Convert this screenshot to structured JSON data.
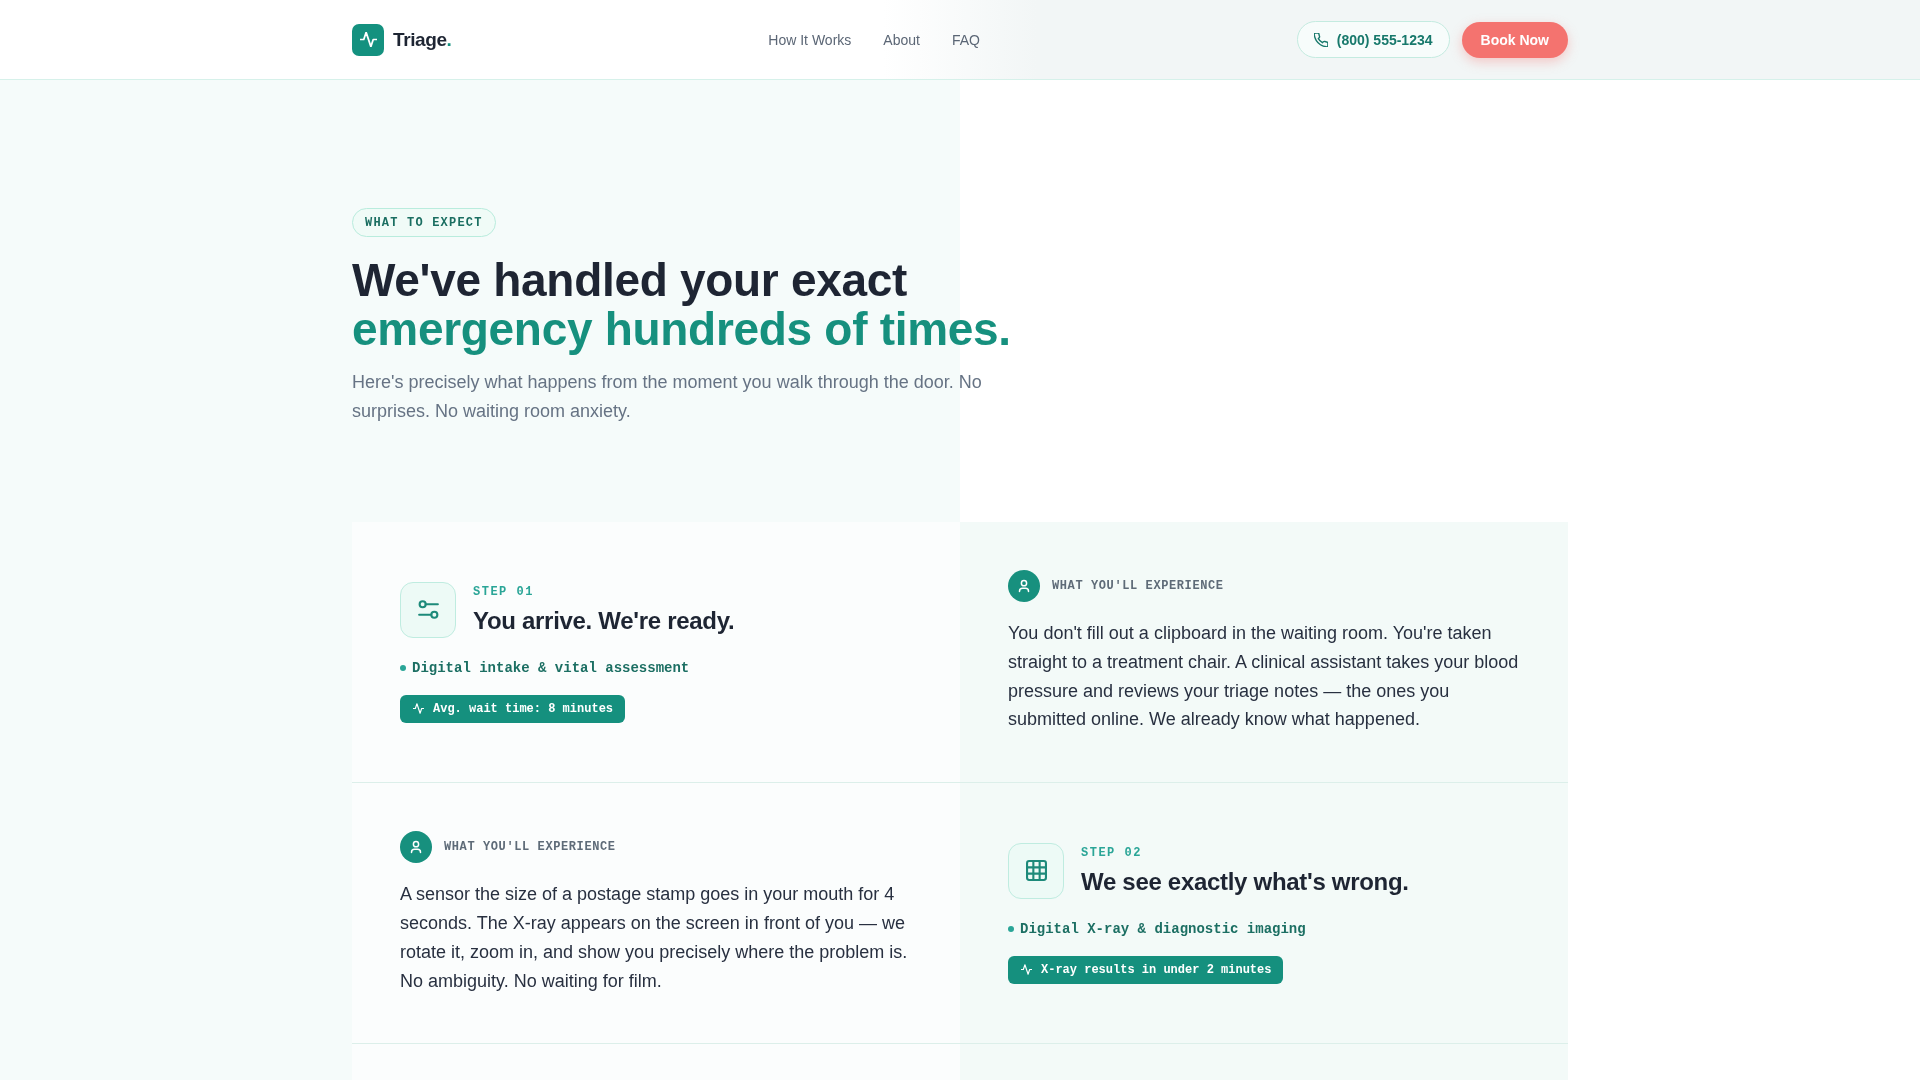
{
  "header": {
    "logo": {
      "name": "Triage",
      "dot": "."
    },
    "nav": [
      {
        "label": "How It Works"
      },
      {
        "label": "About"
      },
      {
        "label": "FAQ"
      }
    ],
    "phone_button": {
      "label": "(800) 555-1234"
    },
    "cta_button": {
      "label": "Book Now"
    }
  },
  "hero": {
    "eyebrow": "WHAT TO EXPECT",
    "headline": {
      "line_1": "We've handled your exact",
      "line_2": "emergency hundreds of times."
    },
    "subtitle": "Here's precisely what happens from the moment you walk through the door. No surprises. No waiting room anxiety."
  },
  "steps": [
    {
      "cells": [
        {
          "kind": "step",
          "step": "STEP 01",
          "title": "You arrive. We're ready.",
          "feature": "Digital intake & vital assessment",
          "stat": "Avg. wait time: 8 minutes"
        },
        {
          "kind": "experience",
          "label": "WHAT YOU'LL EXPERIENCE",
          "text": "You don't fill out a clipboard in the waiting room. You're taken straight to a treatment chair. A clinical assistant takes your blood pressure and reviews your triage notes — the ones you submitted online. We already know what happened."
        }
      ]
    },
    {
      "cells": [
        {
          "kind": "experience",
          "label": "WHAT YOU'LL EXPERIENCE",
          "text": "A sensor the size of a postage stamp goes in your mouth for 4 seconds. The X-ray appears on the screen in front of you — we rotate it, zoom in, and show you precisely where the problem is. No ambiguity. No waiting for film."
        },
        {
          "kind": "step",
          "step": "STEP 02",
          "title": "We see exactly what's wrong.",
          "feature": "Digital X-ray & diagnostic imaging",
          "stat": "X-ray results in under 2 minutes"
        }
      ]
    }
  ]
}
